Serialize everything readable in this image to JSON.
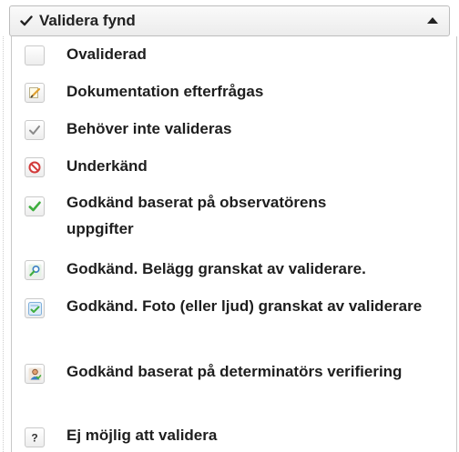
{
  "dropdown": {
    "title": "Validera fynd",
    "check_icon": "checkmark-icon",
    "caret_icon": "caret-up-icon"
  },
  "items": [
    {
      "label": "Ovaliderad",
      "icon": "empty-box-icon"
    },
    {
      "label": "Dokumentation efterfrågas",
      "icon": "pencil-note-icon"
    },
    {
      "label": "Behöver inte valideras",
      "icon": "grey-check-icon"
    },
    {
      "label": "Underkänd",
      "icon": "no-entry-icon"
    },
    {
      "label": "Godkänd baserat på observatörens uppgifter",
      "icon": "green-check-icon"
    },
    {
      "label": "Godkänd. Belägg granskat av validerare.",
      "icon": "magnifier-icon"
    },
    {
      "label": "Godkänd. Foto (eller ljud) granskat av validerare",
      "icon": "photo-check-icon"
    },
    {
      "label": "Godkänd baserat på determinatörs verifiering",
      "icon": "person-icon"
    },
    {
      "label": "Ej möjlig att validera",
      "icon": "question-icon"
    }
  ],
  "colors": {
    "green": "#3fae3f",
    "red": "#d23a3a",
    "blue": "#3b7fc4"
  }
}
